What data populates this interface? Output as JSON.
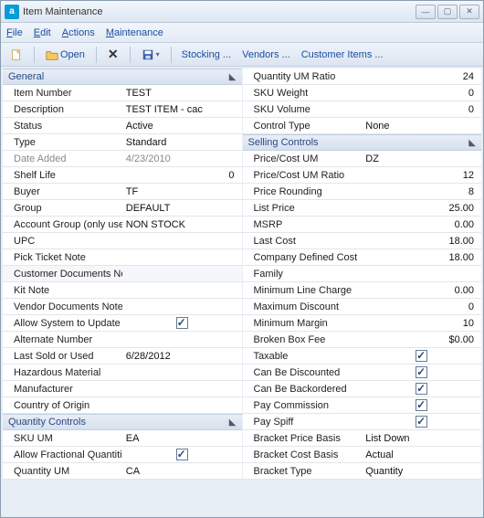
{
  "title": "Item Maintenance",
  "menu": {
    "file": "File",
    "edit": "Edit",
    "actions": "Actions",
    "maintenance": "Maintenance"
  },
  "toolbar": {
    "open": "Open",
    "stocking": "Stocking ...",
    "vendors": "Vendors ...",
    "customerItems": "Customer Items ..."
  },
  "sections": {
    "general": "General",
    "quantityControls": "Quantity Controls",
    "sellingControls": "Selling Controls"
  },
  "general": {
    "itemNumber": {
      "label": "Item Number",
      "value": "TEST"
    },
    "description": {
      "label": "Description",
      "value": "TEST ITEM - cac"
    },
    "status": {
      "label": "Status",
      "value": "Active"
    },
    "type": {
      "label": "Type",
      "value": "Standard"
    },
    "dateAdded": {
      "label": "Date Added",
      "value": "4/23/2010"
    },
    "shelfLife": {
      "label": "Shelf Life",
      "value": "0"
    },
    "buyer": {
      "label": "Buyer",
      "value": "TF"
    },
    "group": {
      "label": "Group",
      "value": "DEFAULT"
    },
    "accountGroup": {
      "label": "Account Group (only used",
      "value": "NON STOCK"
    },
    "upc": {
      "label": "UPC",
      "value": ""
    },
    "pickTicketNote": {
      "label": "Pick Ticket Note",
      "value": ""
    },
    "customerDocumentsNote": {
      "label": "Customer Documents Not",
      "value": ""
    },
    "kitNote": {
      "label": "Kit Note",
      "value": ""
    },
    "vendorDocumentsNote": {
      "label": "Vendor Documents Note",
      "value": ""
    },
    "allowUpdateL": {
      "label": "Allow System to Update L",
      "checked": true
    },
    "alternateNumber": {
      "label": "Alternate Number",
      "value": ""
    },
    "lastSoldOrUsed": {
      "label": "Last Sold or Used",
      "value": "6/28/2012"
    },
    "hazardousMaterial": {
      "label": "Hazardous Material",
      "value": ""
    },
    "manufacturer": {
      "label": "Manufacturer",
      "value": ""
    },
    "countryOfOrigin": {
      "label": "Country of Origin",
      "value": ""
    }
  },
  "qty": {
    "skuUM": {
      "label": "SKU UM",
      "value": "EA"
    },
    "allowFractional": {
      "label": "Allow Fractional Quantitie",
      "checked": true
    },
    "quantityUM": {
      "label": "Quantity UM",
      "value": "CA"
    },
    "quantityUMRatio": {
      "label": "Quantity UM Ratio",
      "value": "24"
    },
    "skuWeight": {
      "label": "SKU Weight",
      "value": "0"
    },
    "skuVolume": {
      "label": "SKU Volume",
      "value": "0"
    },
    "controlType": {
      "label": "Control Type",
      "value": "None"
    }
  },
  "sell": {
    "priceCostUM": {
      "label": "Price/Cost UM",
      "value": "DZ"
    },
    "priceCostUMRatio": {
      "label": "Price/Cost UM Ratio",
      "value": "12"
    },
    "priceRounding": {
      "label": "Price Rounding",
      "value": "8"
    },
    "listPrice": {
      "label": "List Price",
      "value": "25.00"
    },
    "msrp": {
      "label": "MSRP",
      "value": "0.00"
    },
    "lastCost": {
      "label": "Last Cost",
      "value": "18.00"
    },
    "companyDefinedCost": {
      "label": "Company Defined Cost",
      "value": "18.00"
    },
    "family": {
      "label": "Family",
      "value": ""
    },
    "minLineCharge": {
      "label": "Minimum Line Charge",
      "value": "0.00"
    },
    "maxDiscount": {
      "label": "Maximum Discount",
      "value": "0"
    },
    "minMargin": {
      "label": "Minimum Margin",
      "value": "10"
    },
    "brokenBoxFee": {
      "label": "Broken Box Fee",
      "value": "$0.00"
    },
    "taxable": {
      "label": "Taxable",
      "checked": true
    },
    "canBeDiscounted": {
      "label": "Can Be Discounted",
      "checked": true
    },
    "canBeBackordered": {
      "label": "Can Be Backordered",
      "checked": true
    },
    "payCommission": {
      "label": "Pay Commission",
      "checked": true
    },
    "paySpiff": {
      "label": "Pay Spiff",
      "checked": true
    },
    "bracketPriceBasis": {
      "label": "Bracket Price Basis",
      "value": "List Down"
    },
    "bracketCostBasis": {
      "label": "Bracket Cost Basis",
      "value": "Actual"
    },
    "bracketType": {
      "label": "Bracket Type",
      "value": "Quantity"
    }
  }
}
